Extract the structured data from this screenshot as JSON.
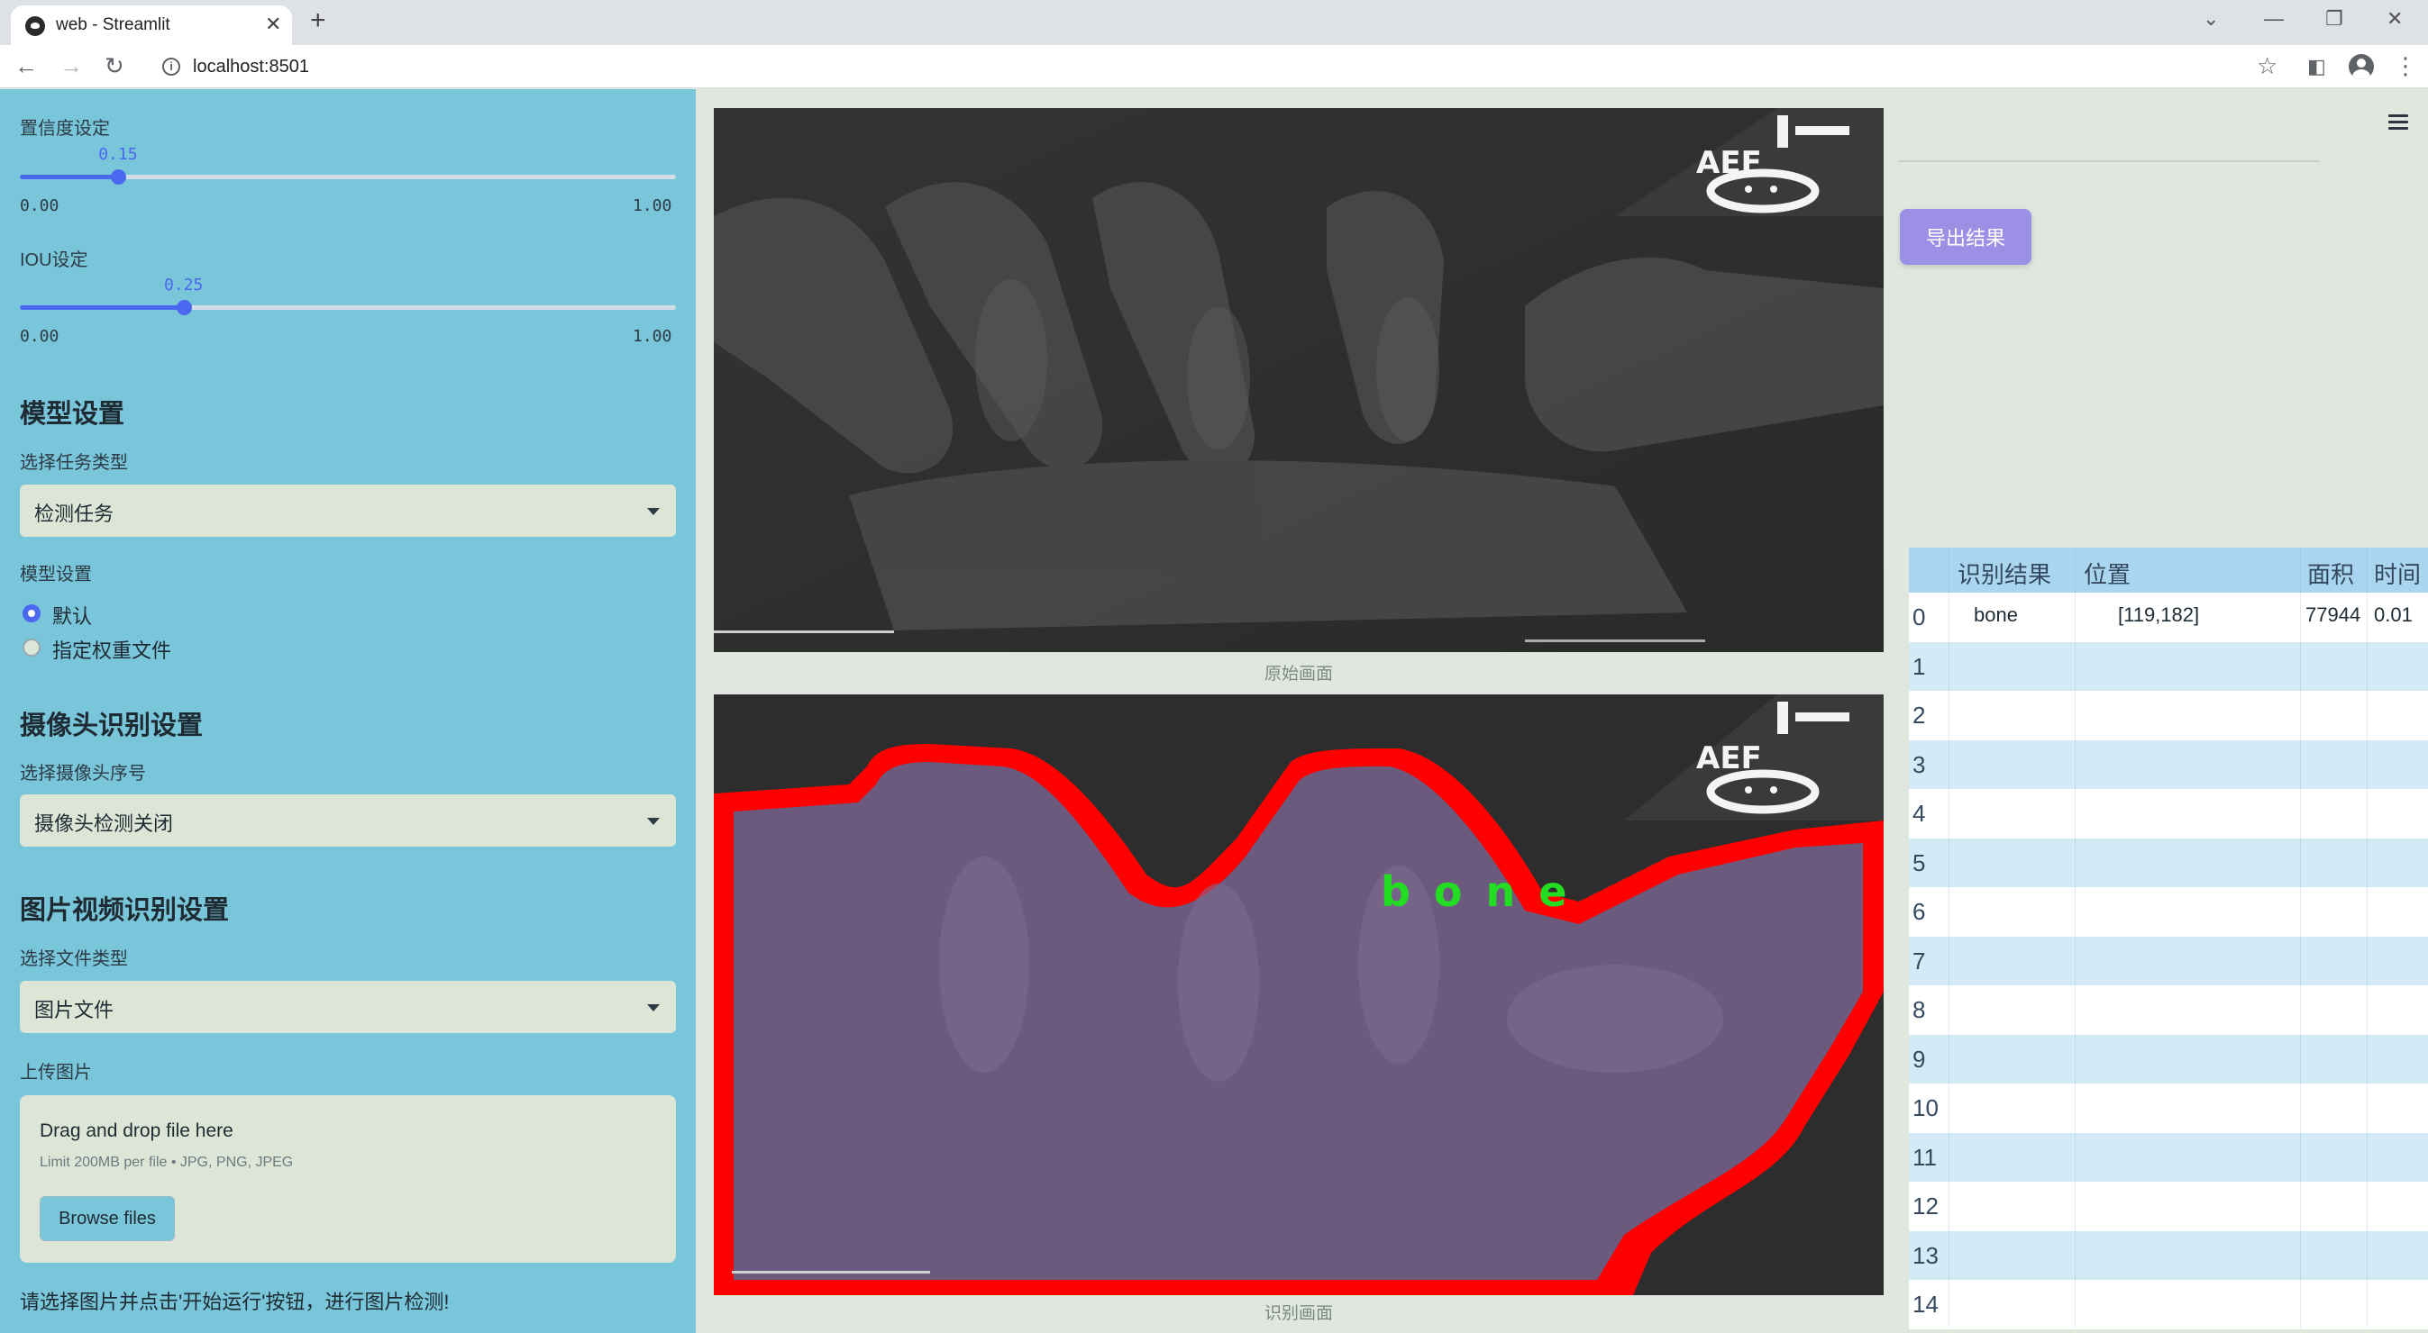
{
  "browser": {
    "tab_title": "web - Streamlit",
    "new_tab": "+",
    "url": "localhost:8501"
  },
  "sidebar": {
    "confidence": {
      "label": "置信度设定",
      "value": "0.15",
      "min": "0.00",
      "max": "1.00",
      "level": 0.15
    },
    "iou": {
      "label": "IOU设定",
      "value": "0.25",
      "min": "0.00",
      "max": "1.00",
      "level": 0.25
    },
    "model_section": {
      "title": "模型设置",
      "task_label": "选择任务类型",
      "task_value": "检测任务",
      "model_label": "模型设置",
      "options": [
        "默认",
        "指定权重文件"
      ],
      "selected": 0
    },
    "camera_section": {
      "title": "摄像头识别设置",
      "camera_label": "选择摄像头序号",
      "camera_value": "摄像头检测关闭"
    },
    "media_section": {
      "title": "图片视频识别设置",
      "file_type_label": "选择文件类型",
      "file_type_value": "图片文件",
      "upload_label": "上传图片",
      "upload_title": "Drag and drop file here",
      "upload_limit": "Limit 200MB per file • JPG, PNG, JPEG",
      "browse_label": "Browse files"
    },
    "hint": "请选择图片并点击'开始运行'按钮，进行图片检测!"
  },
  "main": {
    "original_caption": "原始画面",
    "detected_caption": "识别画面",
    "image_marker": "AEF",
    "detection_label": "bone",
    "colors": {
      "mask": "#6b5a7e",
      "outline": "#ff0000",
      "label": "#22dd22"
    }
  },
  "right": {
    "export_label": "导出结果",
    "table": {
      "headers": [
        "识别结果",
        "位置",
        "面积",
        "时间"
      ],
      "rows": [
        {
          "index": "0",
          "result": "bone",
          "position": "[119,182]",
          "area": "77944",
          "time": "0.01"
        },
        {
          "index": "1"
        },
        {
          "index": "2"
        },
        {
          "index": "3"
        },
        {
          "index": "4"
        },
        {
          "index": "5"
        },
        {
          "index": "6"
        },
        {
          "index": "7"
        },
        {
          "index": "8"
        },
        {
          "index": "9"
        },
        {
          "index": "10"
        },
        {
          "index": "11"
        },
        {
          "index": "12"
        },
        {
          "index": "13"
        },
        {
          "index": "14"
        }
      ]
    }
  }
}
